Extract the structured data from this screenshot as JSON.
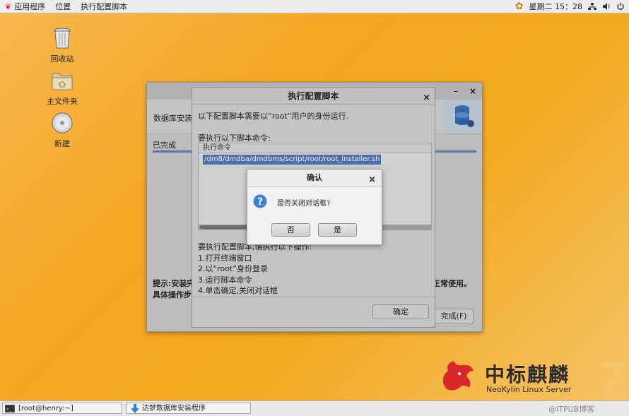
{
  "top_panel": {
    "menus": [
      "应用程序",
      "位置",
      "执行配置脚本"
    ],
    "clock": "星期二 15：28"
  },
  "desktop": {
    "icons": [
      "回收站",
      "主文件夹",
      "新建"
    ]
  },
  "installer": {
    "header_text": "数据库安装​",
    "status": "已完成",
    "hint_left_1": "提示:安装完",
    "hint_left_2": "具体操作步",
    "hint_right": "正常使用。",
    "finish_button": "完成(F)"
  },
  "script_dialog": {
    "title": "执行配置脚本",
    "intro": "以下配置脚本需要以“root”用户的身份运行.",
    "commands_label": "要执行以下脚本命令:",
    "column_header": "执行命令",
    "command": "/dm8/dmdba/dmdbms/script/root/root_installer.sh",
    "steps_title": "要执行配置脚本,请执行以下操作:",
    "steps": [
      "1.打开终端窗口",
      "2.以“root”身份登录",
      "3.运行脚本命令",
      "4.单击确定,关闭对话框"
    ],
    "ok_button": "确定",
    "close_glyph": "×"
  },
  "confirm_dialog": {
    "title": "确认",
    "message": "是否关闭对话框?",
    "no_button": "否",
    "yes_button": "是",
    "close_glyph": "×"
  },
  "branding": {
    "logo_cn": "中标麒麟",
    "logo_en": "NeoKylin Linux Server",
    "version": "7"
  },
  "taskbar": {
    "items": [
      "[root@henry:~]",
      "达梦数据库安装程序"
    ],
    "watermark": "@ITPUB博客"
  },
  "colors": {
    "accent_blue": "#4e6fa9",
    "desktop_orange": "#f5a623"
  }
}
